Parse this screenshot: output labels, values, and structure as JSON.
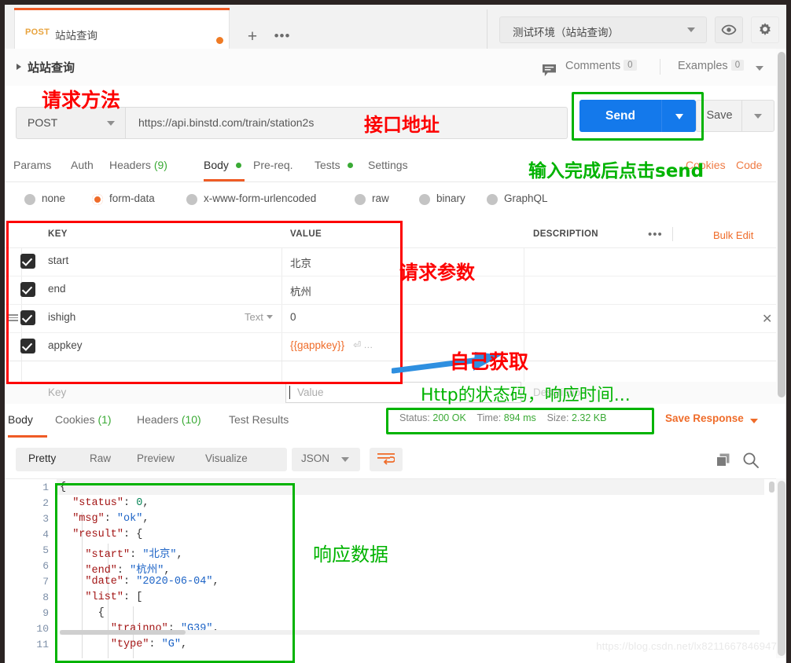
{
  "window": {
    "frame_color": "#2b2423"
  },
  "tabstrip": {
    "request_tab": {
      "method": "POST",
      "name": "站站查询",
      "unsaved_dot": true
    },
    "new_tab_label": "+",
    "more_label": "•••",
    "environment": {
      "selected": "测试环境（站站查询）"
    },
    "eye_icon": "eye-icon",
    "gear_icon": "gear-icon"
  },
  "breadcrumb": {
    "title": "站站查询",
    "comments_label": "Comments",
    "comments_count": "0",
    "examples_label": "Examples",
    "examples_count": "0"
  },
  "url_bar": {
    "method": "POST",
    "url": "https://api.binstd.com/train/station2s",
    "send_label": "Send",
    "save_label": "Save"
  },
  "request_tabs": {
    "items": [
      {
        "label": "Params",
        "active": false
      },
      {
        "label": "Auth",
        "active": false
      },
      {
        "label": "Headers",
        "count": "(9)",
        "active": false
      },
      {
        "label": "Body",
        "dot": true,
        "active": true
      },
      {
        "label": "Pre-req.",
        "active": false
      },
      {
        "label": "Tests",
        "dot": true,
        "active": false
      },
      {
        "label": "Settings",
        "active": false
      }
    ],
    "cookies_link": "Cookies",
    "code_link": "Code"
  },
  "body_types": {
    "options": [
      {
        "label": "none",
        "selected": false
      },
      {
        "label": "form-data",
        "selected": true
      },
      {
        "label": "x-www-form-urlencoded",
        "selected": false
      },
      {
        "label": "raw",
        "selected": false
      },
      {
        "label": "binary",
        "selected": false
      },
      {
        "label": "GraphQL",
        "selected": false
      }
    ]
  },
  "params_table": {
    "headers": {
      "key": "KEY",
      "value": "VALUE",
      "description": "DESCRIPTION"
    },
    "bulk_edit_label": "Bulk Edit",
    "more_label": "•••",
    "rows": [
      {
        "checked": true,
        "key": "start",
        "value": "北京",
        "description": ""
      },
      {
        "checked": true,
        "key": "end",
        "value": "杭州",
        "description": ""
      },
      {
        "checked": true,
        "key": "ishigh",
        "value": "0",
        "description": "",
        "type": "Text",
        "has_remove": true,
        "has_drag": true
      },
      {
        "checked": true,
        "key": "appkey",
        "value": "{{gappkey}}",
        "description": "",
        "is_variable": true
      }
    ],
    "new_row": {
      "key_placeholder": "Key",
      "value_placeholder": "Value",
      "desc_placeholder": "Description"
    }
  },
  "response_tabs": {
    "items": [
      {
        "label": "Body",
        "active": true
      },
      {
        "label": "Cookies",
        "count": "(1)",
        "active": false
      },
      {
        "label": "Headers",
        "count": "(10)",
        "active": false
      },
      {
        "label": "Test Results",
        "active": false
      }
    ],
    "status_label": "Status:",
    "status_value": "200 OK",
    "time_label": "Time:",
    "time_value": "894 ms",
    "size_label": "Size:",
    "size_value": "2.32 KB",
    "save_response_label": "Save Response"
  },
  "response_viewer": {
    "modes": [
      {
        "label": "Pretty",
        "active": true
      },
      {
        "label": "Raw",
        "active": false
      },
      {
        "label": "Preview",
        "active": false
      },
      {
        "label": "Visualize",
        "active": false
      }
    ],
    "format": "JSON",
    "wrap_icon": "word-wrap-icon",
    "copy_icon": "copy-icon",
    "search_icon": "search-icon"
  },
  "response_body": {
    "line_numbers": [
      "1",
      "2",
      "3",
      "4",
      "5",
      "6",
      "7",
      "8",
      "9",
      "10",
      "11"
    ],
    "lines": [
      {
        "n": "1",
        "indent": 0,
        "segments": [
          {
            "t": "{",
            "c": "p"
          }
        ]
      },
      {
        "n": "2",
        "indent": 2,
        "segments": [
          {
            "t": "\"status\"",
            "c": "k"
          },
          {
            "t": ": ",
            "c": "p"
          },
          {
            "t": "0",
            "c": "n"
          },
          {
            "t": ",",
            "c": "p"
          }
        ]
      },
      {
        "n": "3",
        "indent": 2,
        "segments": [
          {
            "t": "\"msg\"",
            "c": "k"
          },
          {
            "t": ": ",
            "c": "p"
          },
          {
            "t": "\"ok\"",
            "c": "s"
          },
          {
            "t": ",",
            "c": "p"
          }
        ]
      },
      {
        "n": "4",
        "indent": 2,
        "segments": [
          {
            "t": "\"result\"",
            "c": "k"
          },
          {
            "t": ": {",
            "c": "p"
          }
        ]
      },
      {
        "n": "5",
        "indent": 4,
        "segments": [
          {
            "t": "\"start\"",
            "c": "k"
          },
          {
            "t": ": ",
            "c": "p"
          },
          {
            "t": "\"北京\"",
            "c": "s"
          },
          {
            "t": ",",
            "c": "p"
          }
        ]
      },
      {
        "n": "6",
        "indent": 4,
        "segments": [
          {
            "t": "\"end\"",
            "c": "k"
          },
          {
            "t": ": ",
            "c": "p"
          },
          {
            "t": "\"杭州\"",
            "c": "s"
          },
          {
            "t": ",",
            "c": "p"
          }
        ]
      },
      {
        "n": "7",
        "indent": 4,
        "segments": [
          {
            "t": "\"date\"",
            "c": "k"
          },
          {
            "t": ": ",
            "c": "p"
          },
          {
            "t": "\"2020-06-04\"",
            "c": "s"
          },
          {
            "t": ",",
            "c": "p"
          }
        ]
      },
      {
        "n": "8",
        "indent": 4,
        "segments": [
          {
            "t": "\"list\"",
            "c": "k"
          },
          {
            "t": ": [",
            "c": "p"
          }
        ]
      },
      {
        "n": "9",
        "indent": 6,
        "segments": [
          {
            "t": "{",
            "c": "p"
          }
        ]
      },
      {
        "n": "10",
        "indent": 8,
        "segments": [
          {
            "t": "\"trainno\"",
            "c": "k"
          },
          {
            "t": ": ",
            "c": "p"
          },
          {
            "t": "\"G39\"",
            "c": "s"
          },
          {
            "t": ",",
            "c": "p"
          }
        ]
      },
      {
        "n": "11",
        "indent": 8,
        "segments": [
          {
            "t": "\"type\"",
            "c": "k"
          },
          {
            "t": ": ",
            "c": "p"
          },
          {
            "t": "\"G\"",
            "c": "s"
          },
          {
            "t": ",",
            "c": "p"
          }
        ]
      }
    ],
    "parsed": {
      "status": 0,
      "msg": "ok",
      "result": {
        "start": "北京",
        "end": "杭州",
        "date": "2020-06-04",
        "list": [
          {
            "trainno": "G39",
            "type": "G"
          }
        ]
      }
    }
  },
  "annotations": {
    "method_note": "请求方法",
    "url_note": "接口地址",
    "send_note": "输入完成后点击send",
    "params_note": "请求参数",
    "appkey_note": "自己获取",
    "status_note": "Http的状态码，响应时间...",
    "response_note": "响应数据",
    "red_color": "#fd0000",
    "green_color": "#00b300",
    "arrow_color": "#2e8fe0"
  },
  "watermark": "https://blog.csdn.net/lx8211667846947"
}
